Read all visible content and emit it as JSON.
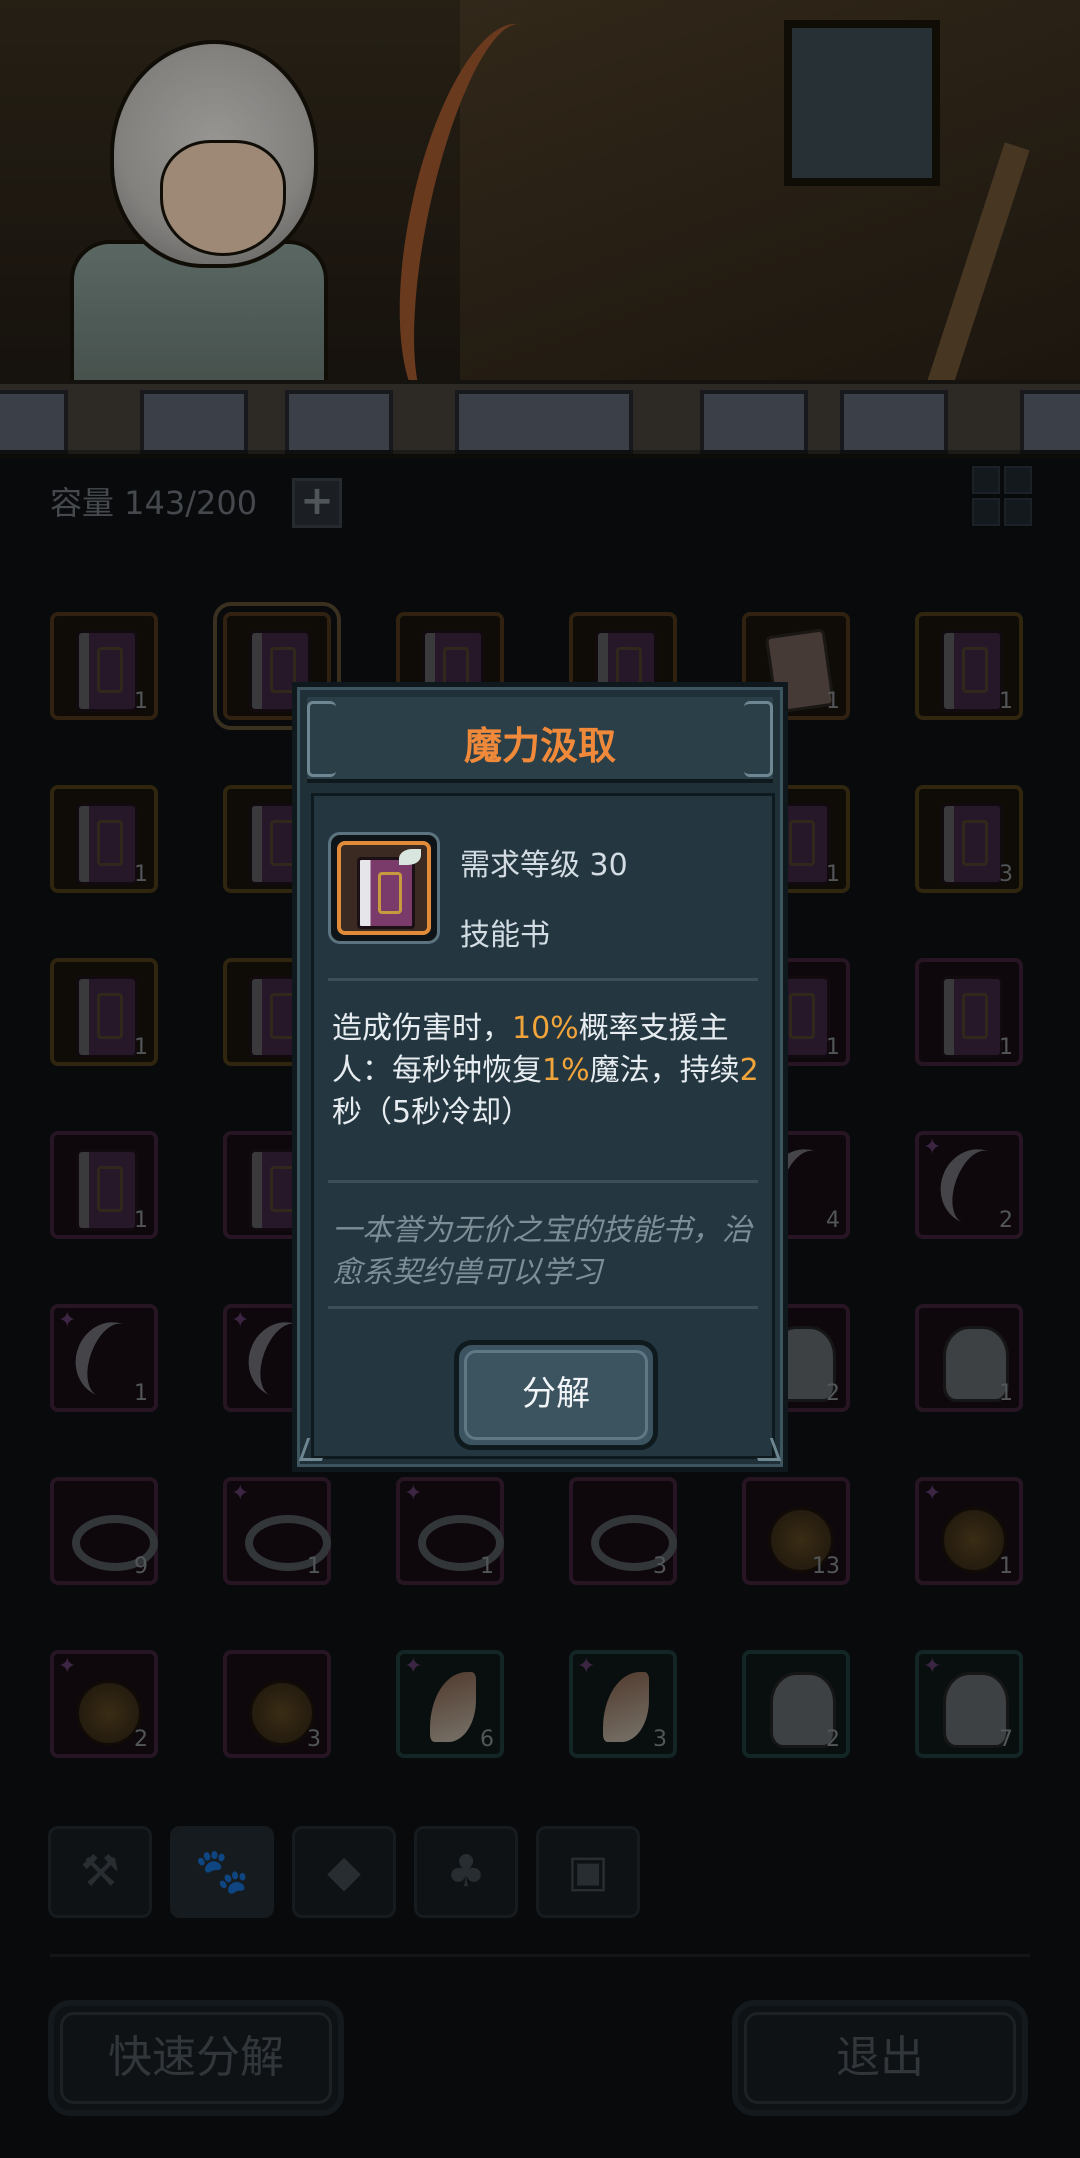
{
  "inventory": {
    "capacity_label": "容量 143/200",
    "add_label": "+",
    "rows": [
      [
        {
          "type": "book",
          "count": "1",
          "rarity": "orange"
        },
        {
          "type": "book",
          "count": "",
          "rarity": "orange",
          "selected": true
        },
        {
          "type": "book",
          "count": "",
          "rarity": "orange"
        },
        {
          "type": "book",
          "count": "",
          "rarity": "orange"
        },
        {
          "type": "card",
          "count": "1",
          "rarity": "orange"
        },
        {
          "type": "book",
          "count": "1",
          "rarity": "gold"
        }
      ],
      [
        {
          "type": "book",
          "count": "1",
          "rarity": "gold"
        },
        {
          "type": "book",
          "count": "",
          "rarity": "gold"
        },
        {
          "type": "book",
          "count": "",
          "rarity": "gold"
        },
        {
          "type": "book",
          "count": "",
          "rarity": "gold"
        },
        {
          "type": "book",
          "count": "1",
          "rarity": "gold"
        },
        {
          "type": "book",
          "count": "3",
          "rarity": "gold"
        }
      ],
      [
        {
          "type": "book",
          "count": "1",
          "rarity": "gold"
        },
        {
          "type": "book",
          "count": "",
          "rarity": "gold"
        },
        {
          "type": "book",
          "count": "",
          "rarity": "gold"
        },
        {
          "type": "book",
          "count": "",
          "rarity": "gold"
        },
        {
          "type": "book",
          "count": "1",
          "rarity": "purple"
        },
        {
          "type": "book",
          "count": "1",
          "rarity": "purple"
        }
      ],
      [
        {
          "type": "book",
          "count": "1",
          "rarity": "purple"
        },
        {
          "type": "book",
          "count": "",
          "rarity": "purple"
        },
        {
          "type": "book",
          "count": "",
          "rarity": "purple"
        },
        {
          "type": "book",
          "count": "",
          "rarity": "purple"
        },
        {
          "type": "claw",
          "count": "4",
          "rarity": "purple"
        },
        {
          "type": "claw",
          "count": "2",
          "rarity": "purple",
          "star": true
        }
      ],
      [
        {
          "type": "claw",
          "count": "1",
          "rarity": "purple",
          "star": true
        },
        {
          "type": "claw",
          "count": "",
          "rarity": "purple",
          "star": true
        },
        {
          "type": "claw",
          "count": "",
          "rarity": "purple"
        },
        {
          "type": "claw",
          "count": "",
          "rarity": "purple"
        },
        {
          "type": "armor",
          "count": "2",
          "rarity": "purple"
        },
        {
          "type": "armor",
          "count": "1",
          "rarity": "purple"
        }
      ],
      [
        {
          "type": "ring",
          "count": "9",
          "rarity": "purple"
        },
        {
          "type": "ring",
          "count": "1",
          "rarity": "purple",
          "star": true
        },
        {
          "type": "ring",
          "count": "1",
          "rarity": "purple",
          "star": true
        },
        {
          "type": "ring",
          "count": "3",
          "rarity": "purple"
        },
        {
          "type": "bell",
          "count": "13",
          "rarity": "purple"
        },
        {
          "type": "bell",
          "count": "1",
          "rarity": "purple",
          "star": true
        }
      ],
      [
        {
          "type": "bell",
          "count": "2",
          "rarity": "purple",
          "star": true
        },
        {
          "type": "bell",
          "count": "3",
          "rarity": "purple"
        },
        {
          "type": "fang",
          "count": "6",
          "rarity": "teal",
          "star": true
        },
        {
          "type": "fang",
          "count": "3",
          "rarity": "teal",
          "star": true
        },
        {
          "type": "armor",
          "count": "2",
          "rarity": "teal"
        },
        {
          "type": "armor",
          "count": "7",
          "rarity": "teal",
          "star": true
        }
      ]
    ]
  },
  "filters": [
    {
      "icon": "hammer-icon",
      "glyph": "⚒"
    },
    {
      "icon": "paw-icon",
      "glyph": "🐾",
      "active": true
    },
    {
      "icon": "gem-icon",
      "glyph": "◆"
    },
    {
      "icon": "club-icon",
      "glyph": "♣"
    },
    {
      "icon": "chest-icon",
      "glyph": "▣"
    }
  ],
  "buttons": {
    "quick_decompose": "快速分解",
    "exit": "退出"
  },
  "modal": {
    "title": "魔力汲取",
    "required_level": "需求等级 30",
    "item_kind": "技能书",
    "desc_parts": [
      {
        "text": "造成伤害时，",
        "hl": false
      },
      {
        "text": "10%",
        "hl": true
      },
      {
        "text": "概率支援主人：每秒钟恢复",
        "hl": false
      },
      {
        "text": "1%",
        "hl": true
      },
      {
        "text": "魔法，持续",
        "hl": false
      },
      {
        "text": "2",
        "hl": true
      },
      {
        "text": "秒（5秒冷却）",
        "hl": false
      }
    ],
    "flavor": "一本誉为无价之宝的技能书，治愈系契约兽可以学习",
    "decompose_button": "分解",
    "highlight_color": "#f0a43a",
    "title_color": "#f08a3a"
  }
}
